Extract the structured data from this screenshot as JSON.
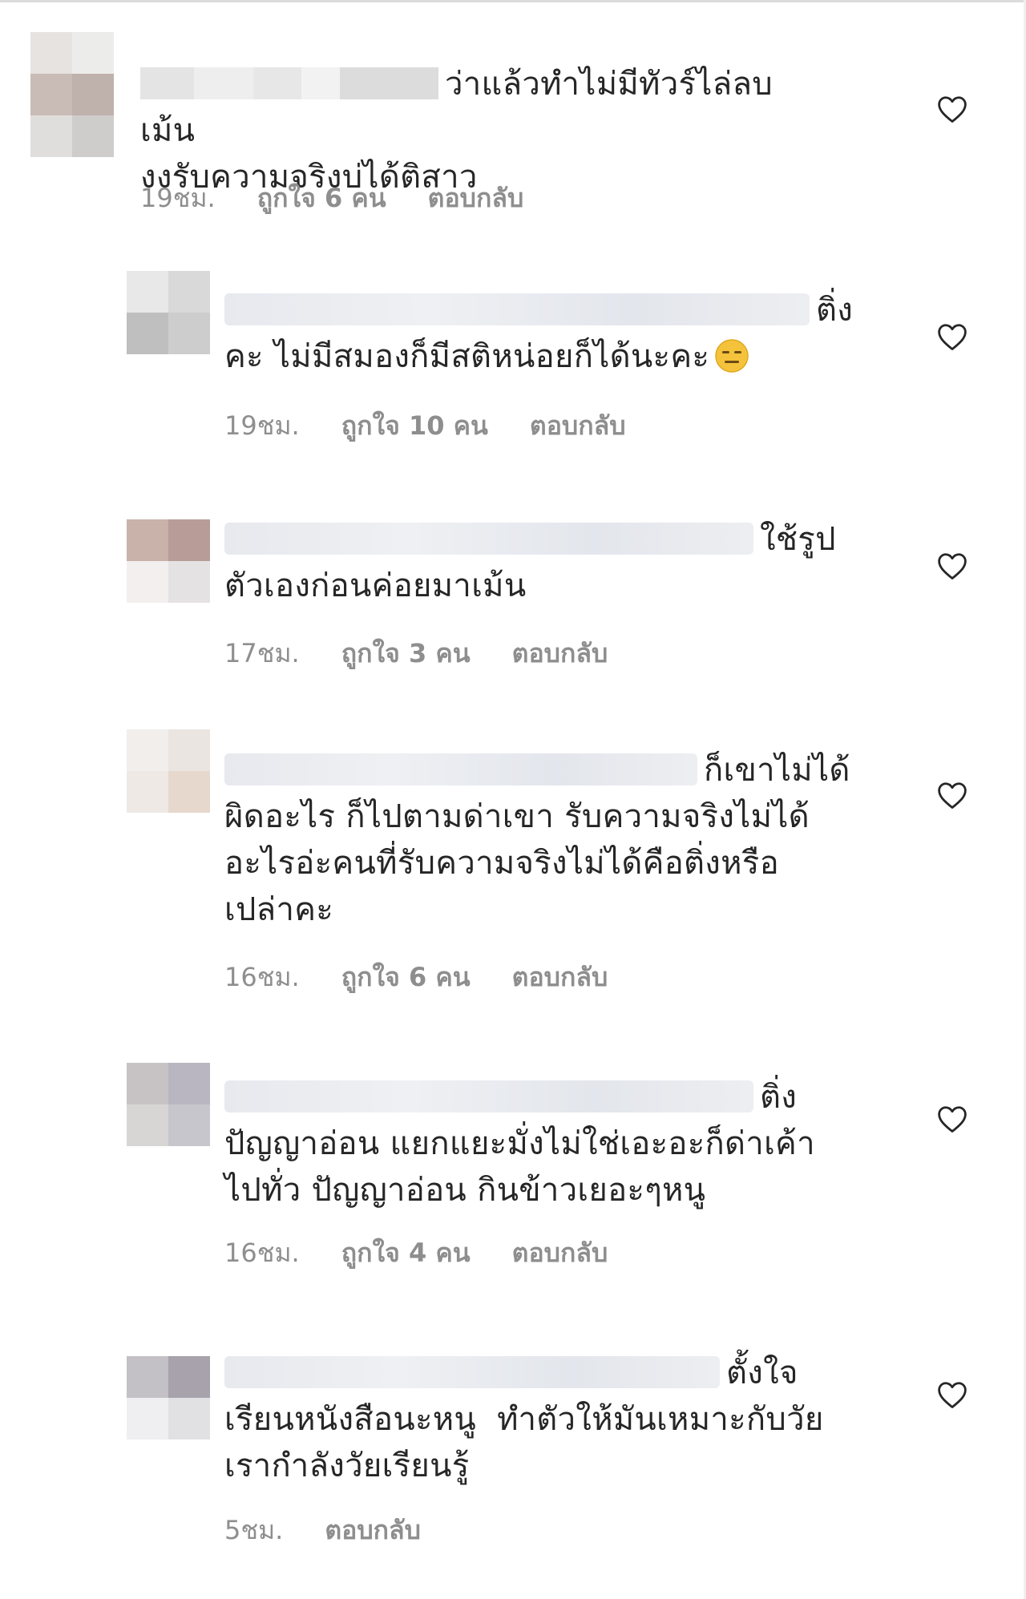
{
  "comments": [
    {
      "text": "ว่าแล้วทำไม่มีทัวร์ไล่ลบเม้น\nงงรับความจริงบ่ได้ติสาว",
      "time": "19ชม.",
      "likes": "ถูกใจ 6 คน",
      "reply": "ตอบกลับ",
      "avatar_colors": [
        "#e6e3e1",
        "#ececea",
        "#c9bbb5",
        "#bfb1ab",
        "#e0dedd",
        "#cfcccc"
      ]
    },
    {
      "text": "ติ่ง\nคะ ไม่มีสมองก็มีสติหน่อยก็ได้นะคะ",
      "emoji": "expressionless-face",
      "time": "19ชม.",
      "likes": "ถูกใจ 10 คน",
      "reply": "ตอบกลับ",
      "avatar_colors": [
        "#e8e8e8",
        "#d9d9d9",
        "#bfbfbf",
        "#cdcdcd"
      ]
    },
    {
      "text": "ใช้รูป\nตัวเองก่อนค่อยมาเม้น",
      "time": "17ชม.",
      "likes": "ถูกใจ 3 คน",
      "reply": "ตอบกลับ",
      "avatar_colors": [
        "#c9b2aa",
        "#b89c98",
        "#f3efee",
        "#e5e2e3"
      ]
    },
    {
      "text": "ก็เขาไม่ได้\nผิดอะไร ก็ไปตามด่าเขา รับความจริงไม่ได้\nอะไรอ่ะคนที่รับความจริงไม่ได้คือติ่งหรือ\nเปล่าคะ",
      "time": "16ชม.",
      "likes": "ถูกใจ 6 คน",
      "reply": "ตอบกลับ",
      "avatar_colors": [
        "#f1eeec",
        "#ebe5e2",
        "#efe9e6",
        "#e7d8cd"
      ]
    },
    {
      "text": "ติ่ง\nปัญญาอ่อน แยกแยะมั่งไม่ใช่เอะอะก็ด่าเค้า\nไปทั่ว ปัญญาอ่อน กินข้าวเยอะๆหนู",
      "time": "16ชม.",
      "likes": "ถูกใจ 4 คน",
      "reply": "ตอบกลับ",
      "avatar_colors": [
        "#c7c3c4",
        "#b9b6c1",
        "#d8d5d5",
        "#c7c6cd"
      ]
    },
    {
      "text": "ตั้งใจ\nเรียนหนังสือนะหนู  ทำตัวให้มันเหมาะกับวัย\nเรากำลังวัยเรียนรู้",
      "time": "5ชม.",
      "likes": "",
      "reply": "ตอบกลับ",
      "avatar_colors": [
        "#c3c0c6",
        "#a7a2ab",
        "#efeff1",
        "#e1e1e3"
      ]
    }
  ]
}
